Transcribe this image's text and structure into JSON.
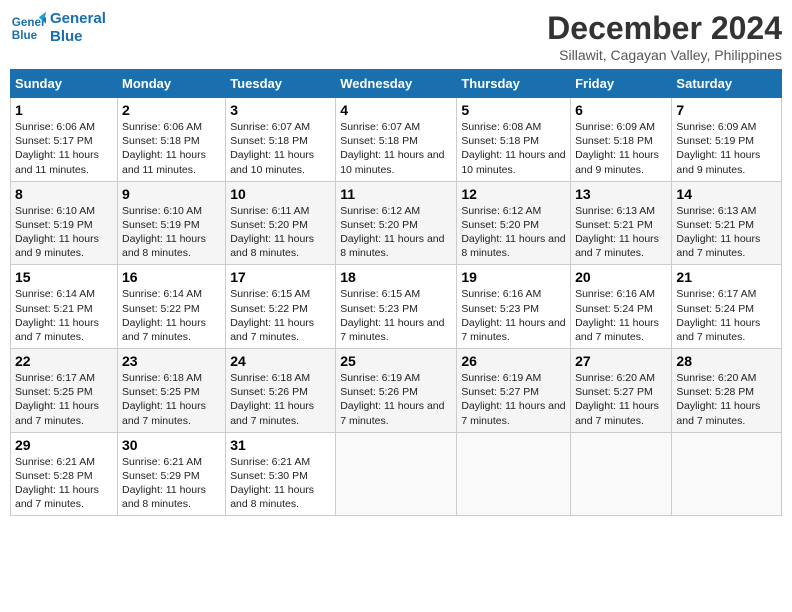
{
  "logo": {
    "line1": "General",
    "line2": "Blue"
  },
  "title": "December 2024",
  "subtitle": "Sillawit, Cagayan Valley, Philippines",
  "days_of_week": [
    "Sunday",
    "Monday",
    "Tuesday",
    "Wednesday",
    "Thursday",
    "Friday",
    "Saturday"
  ],
  "weeks": [
    [
      {
        "day": "1",
        "sunrise": "Sunrise: 6:06 AM",
        "sunset": "Sunset: 5:17 PM",
        "daylight": "Daylight: 11 hours and 11 minutes."
      },
      {
        "day": "2",
        "sunrise": "Sunrise: 6:06 AM",
        "sunset": "Sunset: 5:18 PM",
        "daylight": "Daylight: 11 hours and 11 minutes."
      },
      {
        "day": "3",
        "sunrise": "Sunrise: 6:07 AM",
        "sunset": "Sunset: 5:18 PM",
        "daylight": "Daylight: 11 hours and 10 minutes."
      },
      {
        "day": "4",
        "sunrise": "Sunrise: 6:07 AM",
        "sunset": "Sunset: 5:18 PM",
        "daylight": "Daylight: 11 hours and 10 minutes."
      },
      {
        "day": "5",
        "sunrise": "Sunrise: 6:08 AM",
        "sunset": "Sunset: 5:18 PM",
        "daylight": "Daylight: 11 hours and 10 minutes."
      },
      {
        "day": "6",
        "sunrise": "Sunrise: 6:09 AM",
        "sunset": "Sunset: 5:18 PM",
        "daylight": "Daylight: 11 hours and 9 minutes."
      },
      {
        "day": "7",
        "sunrise": "Sunrise: 6:09 AM",
        "sunset": "Sunset: 5:19 PM",
        "daylight": "Daylight: 11 hours and 9 minutes."
      }
    ],
    [
      {
        "day": "8",
        "sunrise": "Sunrise: 6:10 AM",
        "sunset": "Sunset: 5:19 PM",
        "daylight": "Daylight: 11 hours and 9 minutes."
      },
      {
        "day": "9",
        "sunrise": "Sunrise: 6:10 AM",
        "sunset": "Sunset: 5:19 PM",
        "daylight": "Daylight: 11 hours and 8 minutes."
      },
      {
        "day": "10",
        "sunrise": "Sunrise: 6:11 AM",
        "sunset": "Sunset: 5:20 PM",
        "daylight": "Daylight: 11 hours and 8 minutes."
      },
      {
        "day": "11",
        "sunrise": "Sunrise: 6:12 AM",
        "sunset": "Sunset: 5:20 PM",
        "daylight": "Daylight: 11 hours and 8 minutes."
      },
      {
        "day": "12",
        "sunrise": "Sunrise: 6:12 AM",
        "sunset": "Sunset: 5:20 PM",
        "daylight": "Daylight: 11 hours and 8 minutes."
      },
      {
        "day": "13",
        "sunrise": "Sunrise: 6:13 AM",
        "sunset": "Sunset: 5:21 PM",
        "daylight": "Daylight: 11 hours and 7 minutes."
      },
      {
        "day": "14",
        "sunrise": "Sunrise: 6:13 AM",
        "sunset": "Sunset: 5:21 PM",
        "daylight": "Daylight: 11 hours and 7 minutes."
      }
    ],
    [
      {
        "day": "15",
        "sunrise": "Sunrise: 6:14 AM",
        "sunset": "Sunset: 5:21 PM",
        "daylight": "Daylight: 11 hours and 7 minutes."
      },
      {
        "day": "16",
        "sunrise": "Sunrise: 6:14 AM",
        "sunset": "Sunset: 5:22 PM",
        "daylight": "Daylight: 11 hours and 7 minutes."
      },
      {
        "day": "17",
        "sunrise": "Sunrise: 6:15 AM",
        "sunset": "Sunset: 5:22 PM",
        "daylight": "Daylight: 11 hours and 7 minutes."
      },
      {
        "day": "18",
        "sunrise": "Sunrise: 6:15 AM",
        "sunset": "Sunset: 5:23 PM",
        "daylight": "Daylight: 11 hours and 7 minutes."
      },
      {
        "day": "19",
        "sunrise": "Sunrise: 6:16 AM",
        "sunset": "Sunset: 5:23 PM",
        "daylight": "Daylight: 11 hours and 7 minutes."
      },
      {
        "day": "20",
        "sunrise": "Sunrise: 6:16 AM",
        "sunset": "Sunset: 5:24 PM",
        "daylight": "Daylight: 11 hours and 7 minutes."
      },
      {
        "day": "21",
        "sunrise": "Sunrise: 6:17 AM",
        "sunset": "Sunset: 5:24 PM",
        "daylight": "Daylight: 11 hours and 7 minutes."
      }
    ],
    [
      {
        "day": "22",
        "sunrise": "Sunrise: 6:17 AM",
        "sunset": "Sunset: 5:25 PM",
        "daylight": "Daylight: 11 hours and 7 minutes."
      },
      {
        "day": "23",
        "sunrise": "Sunrise: 6:18 AM",
        "sunset": "Sunset: 5:25 PM",
        "daylight": "Daylight: 11 hours and 7 minutes."
      },
      {
        "day": "24",
        "sunrise": "Sunrise: 6:18 AM",
        "sunset": "Sunset: 5:26 PM",
        "daylight": "Daylight: 11 hours and 7 minutes."
      },
      {
        "day": "25",
        "sunrise": "Sunrise: 6:19 AM",
        "sunset": "Sunset: 5:26 PM",
        "daylight": "Daylight: 11 hours and 7 minutes."
      },
      {
        "day": "26",
        "sunrise": "Sunrise: 6:19 AM",
        "sunset": "Sunset: 5:27 PM",
        "daylight": "Daylight: 11 hours and 7 minutes."
      },
      {
        "day": "27",
        "sunrise": "Sunrise: 6:20 AM",
        "sunset": "Sunset: 5:27 PM",
        "daylight": "Daylight: 11 hours and 7 minutes."
      },
      {
        "day": "28",
        "sunrise": "Sunrise: 6:20 AM",
        "sunset": "Sunset: 5:28 PM",
        "daylight": "Daylight: 11 hours and 7 minutes."
      }
    ],
    [
      {
        "day": "29",
        "sunrise": "Sunrise: 6:21 AM",
        "sunset": "Sunset: 5:28 PM",
        "daylight": "Daylight: 11 hours and 7 minutes."
      },
      {
        "day": "30",
        "sunrise": "Sunrise: 6:21 AM",
        "sunset": "Sunset: 5:29 PM",
        "daylight": "Daylight: 11 hours and 8 minutes."
      },
      {
        "day": "31",
        "sunrise": "Sunrise: 6:21 AM",
        "sunset": "Sunset: 5:30 PM",
        "daylight": "Daylight: 11 hours and 8 minutes."
      },
      null,
      null,
      null,
      null
    ]
  ]
}
